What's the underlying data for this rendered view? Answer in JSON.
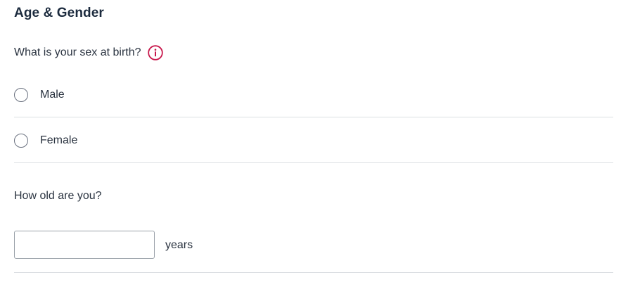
{
  "section": {
    "title": "Age & Gender"
  },
  "sex_question": {
    "text": "What is your sex at birth?",
    "info_icon": "info-circle-icon",
    "info_color": "#c8174b",
    "options": [
      {
        "label": "Male",
        "selected": false
      },
      {
        "label": "Female",
        "selected": false
      }
    ]
  },
  "age_question": {
    "text": "How old are you?",
    "input_value": "",
    "input_placeholder": "",
    "unit": "years"
  }
}
